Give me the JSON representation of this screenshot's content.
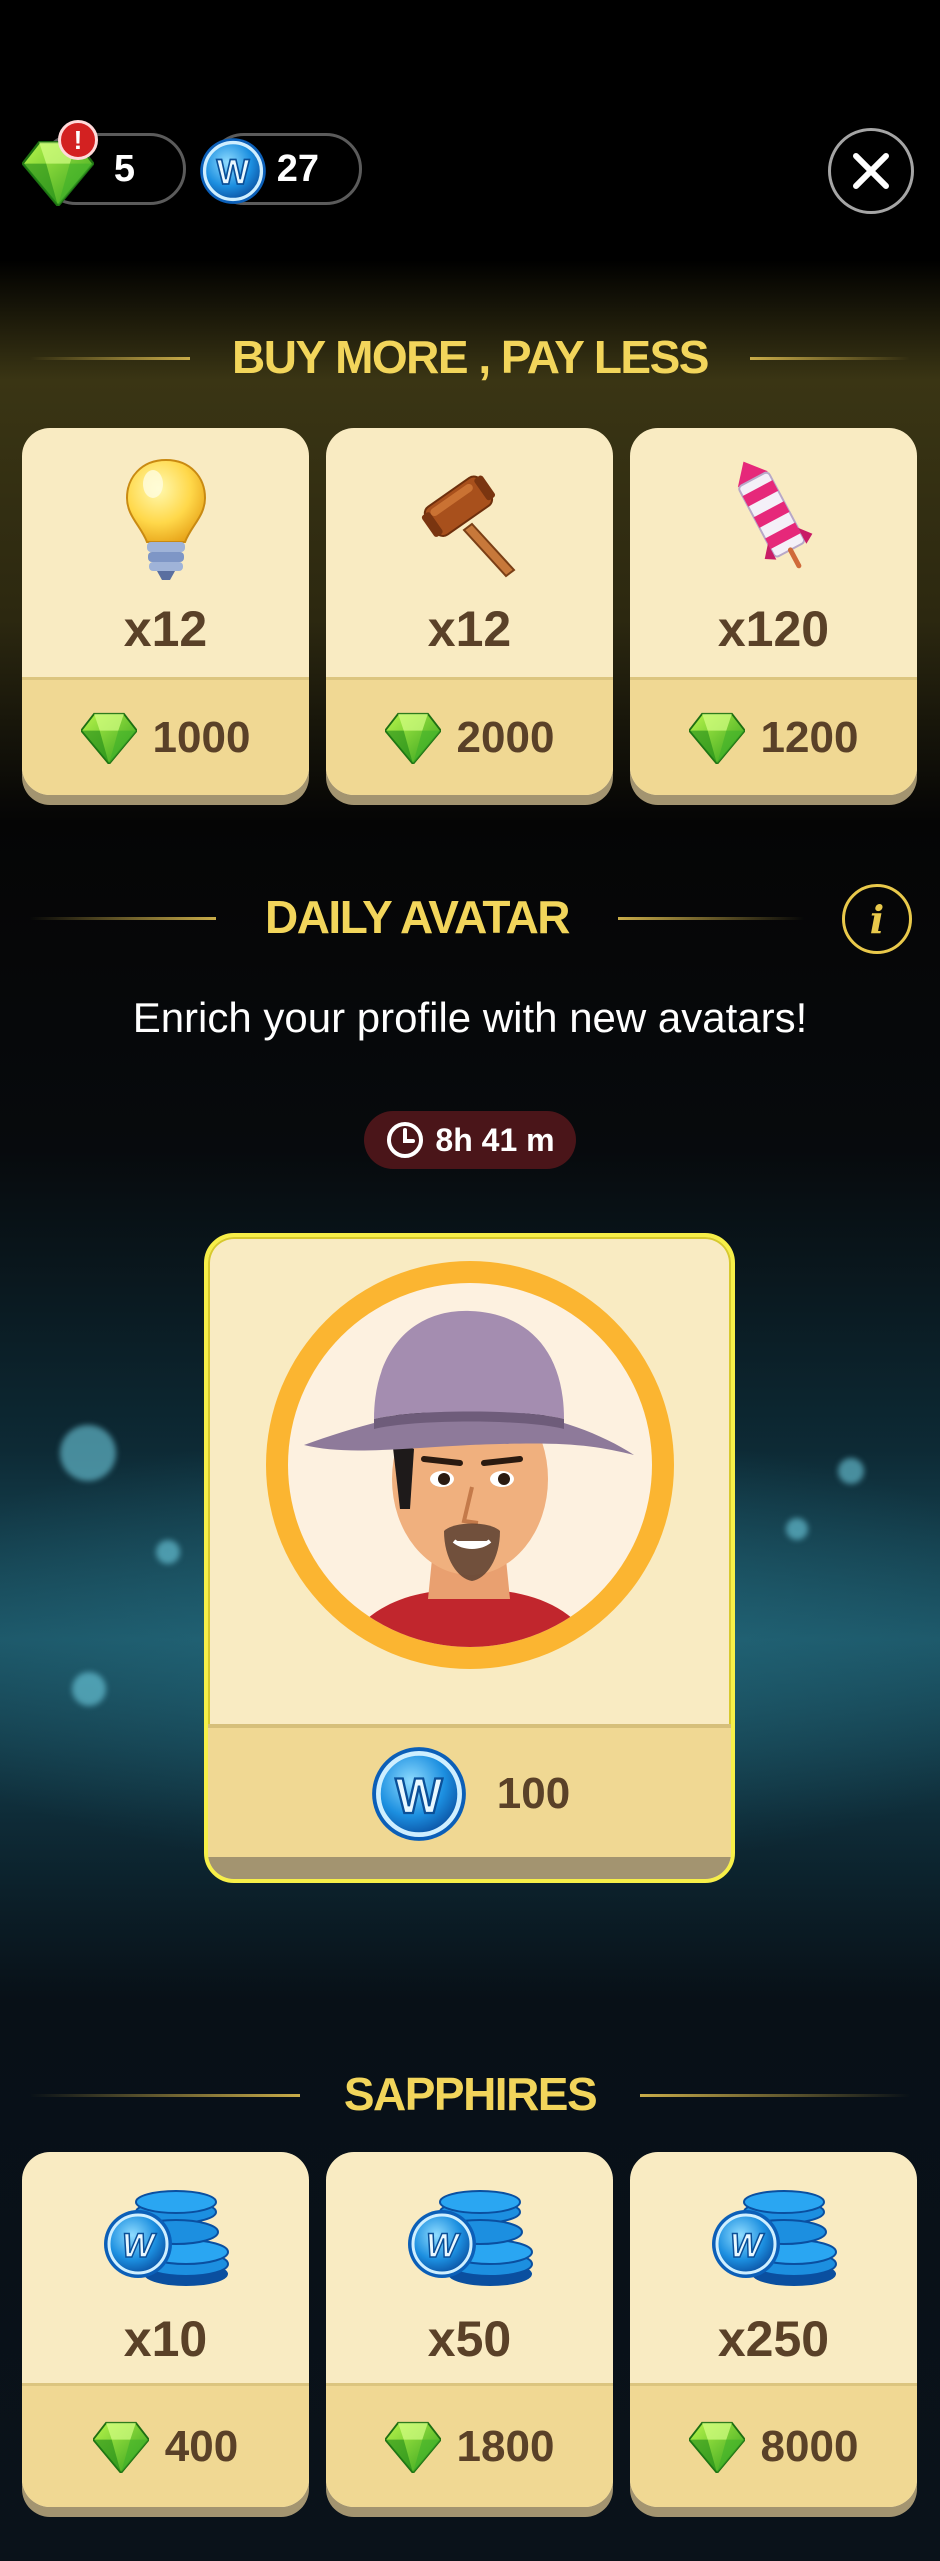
{
  "top_bar": {
    "gem_count": "5",
    "alert_mark": "!",
    "coin_count": "27",
    "close_icon": "close-icon"
  },
  "buy_more": {
    "title": "BUY MORE , PAY LESS",
    "items": [
      {
        "icon": "lightbulb-icon",
        "qty": "x12",
        "price": "1000"
      },
      {
        "icon": "hammer-icon",
        "qty": "x12",
        "price": "2000"
      },
      {
        "icon": "firework-rocket-icon",
        "qty": "x120",
        "price": "1200"
      }
    ]
  },
  "daily_avatar": {
    "title": "DAILY AVATAR",
    "info_glyph": "i",
    "subtitle": "Enrich your profile with new avatars!",
    "timer": "8h 41 m",
    "avatar_icon": "cowboy-avatar-icon",
    "price": "100"
  },
  "sapphires": {
    "title": "SAPPHIRES",
    "items": [
      {
        "icon": "coin-stack-icon",
        "qty": "x10",
        "price": "400"
      },
      {
        "icon": "coin-stack-icon",
        "qty": "x50",
        "price": "1800"
      },
      {
        "icon": "coin-stack-icon",
        "qty": "x250",
        "price": "8000"
      }
    ]
  },
  "colors": {
    "title_gold": "#f2d55b",
    "card_bg": "#f9ebc2",
    "price_bar": "#f0d893",
    "text_brown": "#5a4128",
    "timer_bg": "#4a1519"
  }
}
